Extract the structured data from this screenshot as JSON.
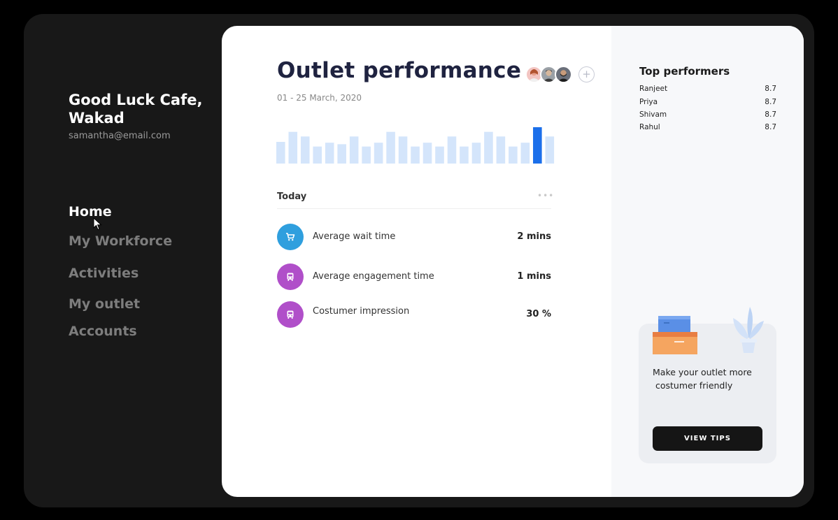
{
  "sidebar": {
    "cafe_name_line1": "Good Luck Cafe,",
    "cafe_name_line2": "Wakad",
    "email": "samantha@email.com",
    "nav": [
      {
        "label": "Home",
        "active": true
      },
      {
        "label": "My Workforce",
        "active": false
      },
      {
        "label": "Activities",
        "active": false
      },
      {
        "label": "My outlet",
        "active": false
      },
      {
        "label": "Accounts",
        "active": false
      }
    ]
  },
  "main": {
    "title": "Outlet performance",
    "date_range": "01 - 25 March, 2020",
    "add_member_icon": "plus-icon",
    "today": {
      "label": "Today",
      "more": "•••",
      "metrics": [
        {
          "icon": "cart-icon",
          "color": "#2f9fde",
          "label": "Average wait time",
          "value": "2 mins"
        },
        {
          "icon": "bus-icon",
          "color": "#b04fc9",
          "label": "Average engagement time",
          "value": "1 mins"
        },
        {
          "icon": "bus-icon",
          "color": "#b04fc9",
          "label": "Costumer impression",
          "value": "30 %"
        }
      ]
    }
  },
  "chart_data": {
    "type": "bar",
    "values": [
      28,
      41,
      35,
      22,
      27,
      25,
      35,
      22,
      27,
      41,
      35,
      22,
      27,
      22,
      35,
      22,
      27,
      41,
      35,
      22,
      27,
      47,
      35
    ],
    "highlight_index": 21,
    "colors": {
      "bar": "#d4e5fb",
      "highlight": "#1b6fea"
    }
  },
  "top_performers": {
    "title": "Top performers",
    "rows": [
      {
        "name": "Ranjeet",
        "score": "8.7"
      },
      {
        "name": "Priya",
        "score": "8.7"
      },
      {
        "name": "Shivam",
        "score": "8.7"
      },
      {
        "name": "Rahul",
        "score": "8.7"
      }
    ]
  },
  "tips": {
    "line1": "Make your outlet more",
    "line2": " costumer friendly",
    "button": "VIEW TIPS"
  }
}
